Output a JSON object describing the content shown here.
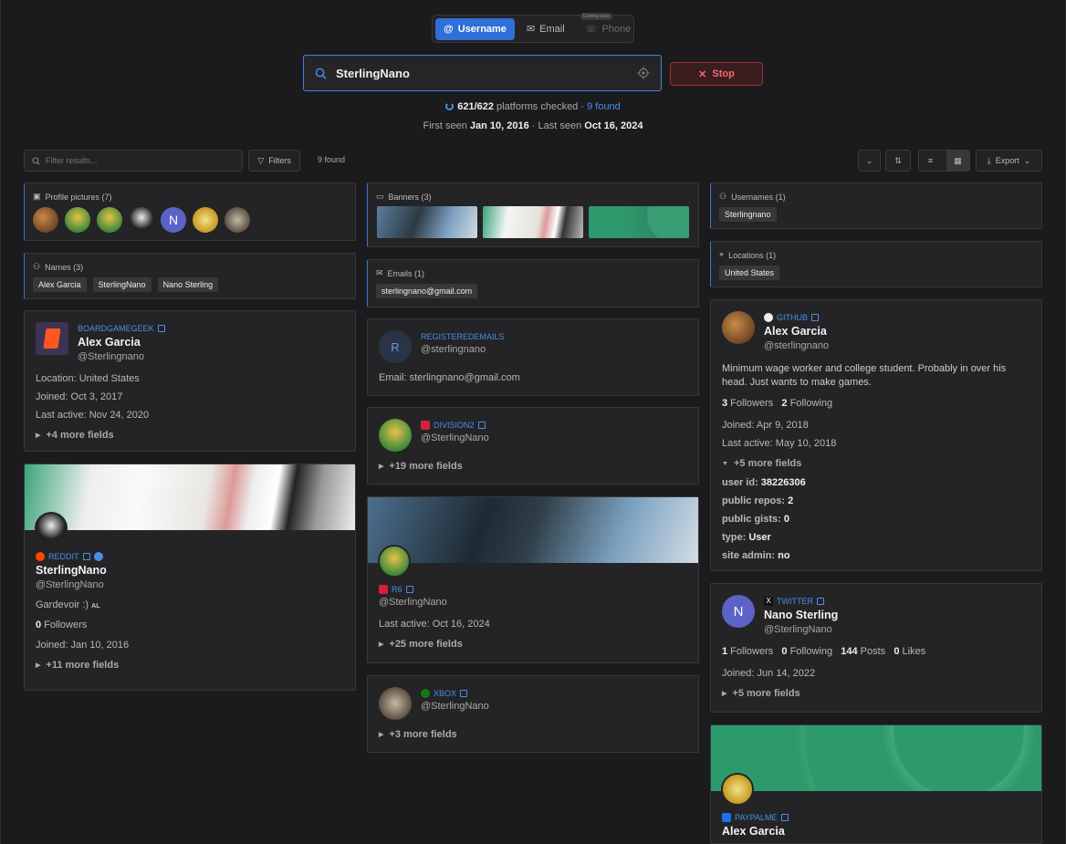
{
  "tabs": {
    "username": "Username",
    "email": "Email",
    "phone": "Phone",
    "coming_soon": "Coming soon"
  },
  "search": {
    "value": "SterlingNano",
    "stop": "Stop"
  },
  "progress": {
    "checked": "621",
    "total": "/622",
    "label": " platforms checked",
    "sep": " · ",
    "found": "9 found",
    "fraction": 0.998
  },
  "seen": {
    "first_label": "First seen ",
    "first": "Jan 10, 2016",
    "mid": " · Last seen ",
    "last": "Oct 16, 2024"
  },
  "toolbar": {
    "filter_placeholder": "Filter results...",
    "filters": "Filters",
    "found": "9 found",
    "export": "Export"
  },
  "profile_pictures": {
    "title": "Profile pictures (7)",
    "letter": "N"
  },
  "banners": {
    "title": "Banners (3)"
  },
  "usernames": {
    "title": "Usernames (1)",
    "items": [
      "Sterlingnano"
    ]
  },
  "names": {
    "title": "Names (3)",
    "items": [
      "Alex Garcia",
      "SterlingNano",
      "Nano Sterling"
    ]
  },
  "emails": {
    "title": "Emails (1)",
    "items": [
      "sterlingnano@gmail.com"
    ]
  },
  "locations": {
    "title": "Locations (1)",
    "items": [
      "United States"
    ]
  },
  "bgg": {
    "platform": "BOARDGAMEGEEK",
    "name": "Alex Garcia",
    "handle": "@Sterlingnano",
    "location": "Location: United States",
    "joined": "Joined: Oct 3, 2017",
    "last_active": "Last active: Nov 24, 2020",
    "more": "+4 more fields"
  },
  "reddit": {
    "platform": "REDDIT",
    "name": "SterlingNano",
    "handle": "@SterlingNano",
    "bio": "Gardevoir :)",
    "bio_tag": "AL",
    "followers_n": "0",
    "followers": " Followers",
    "joined": "Joined: Jan 10, 2016",
    "more": "+11 more fields"
  },
  "regemails": {
    "platform": "REGISTEREDEMAILS",
    "letter": "R",
    "handle": "@sterlingnano",
    "email": "Email: sterlingnano@gmail.com"
  },
  "division2": {
    "platform": "DIVISION2",
    "handle": "@SterlingNano",
    "more": "+19 more fields"
  },
  "r6": {
    "platform": "R6",
    "handle": "@SterlingNano",
    "last_active": "Last active: Oct 16, 2024",
    "more": "+25 more fields"
  },
  "xbox": {
    "platform": "XBOX",
    "handle": "@SterlingNano",
    "more": "+3 more fields"
  },
  "github": {
    "platform": "GITHUB",
    "name": "Alex Garcia",
    "handle": "@sterlingnano",
    "bio": "Minimum wage worker and college student. Probably in over his head. Just wants to make games.",
    "followers_n": "3",
    "followers": " Followers",
    "following_n": "2",
    "following": " Following",
    "joined": "Joined: Apr 9, 2018",
    "last_active": "Last active: May 10, 2018",
    "more": "+5 more fields",
    "f1k": "user id: ",
    "f1v": "38226306",
    "f2k": "public repos: ",
    "f2v": "2",
    "f3k": "public gists: ",
    "f3v": "0",
    "f4k": "type: ",
    "f4v": "User",
    "f5k": "site admin: ",
    "f5v": "no"
  },
  "twitter": {
    "platform": "TWITTER",
    "letter": "N",
    "name": "Nano Sterling",
    "handle": "@SterlingNano",
    "followers_n": "1",
    "followers": " Followers",
    "following_n": "0",
    "following": " Following",
    "posts_n": "144",
    "posts": " Posts",
    "likes_n": "0",
    "likes": " Likes",
    "joined": "Joined: Jun 14, 2022",
    "more": "+5 more fields"
  },
  "paypal": {
    "platform": "PAYPALME",
    "name": "Alex Garcia"
  },
  "colors": {
    "accent": "#2e6fd8",
    "link": "#4a8fe7",
    "stop": "#f06a6f",
    "bg": "#1b1b1d",
    "card": "#242426"
  }
}
